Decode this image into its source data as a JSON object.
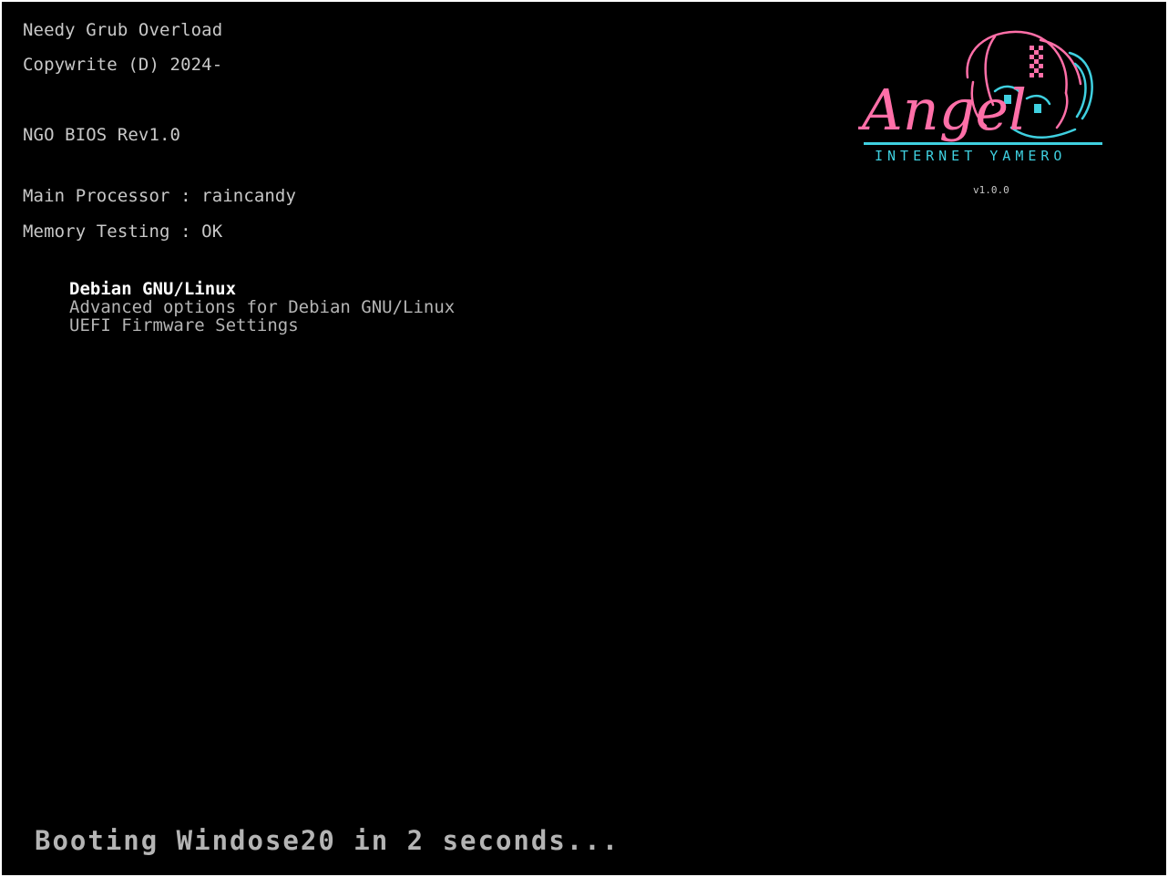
{
  "header": {
    "title": "Needy Grub Overload",
    "copyright": "Copywrite (D) 2024-",
    "bios_rev": "NGO BIOS Rev1.0"
  },
  "system": {
    "processor": "Main Processor : raincandy",
    "memory": "Memory Testing : OK"
  },
  "logo": {
    "name": "Angel",
    "subtitle": "INTERNET YAMERO",
    "version": "v1.0.0",
    "pink": "#ff6fa8",
    "cyan": "#3fd0e0"
  },
  "menu": {
    "items": [
      {
        "label": "Debian GNU/Linux",
        "selected": true
      },
      {
        "label": "Advanced options for Debian GNU/Linux",
        "selected": false
      },
      {
        "label": "UEFI Firmware Settings",
        "selected": false
      }
    ]
  },
  "footer": {
    "boot_message": "Booting Windose20 in 2 seconds..."
  }
}
